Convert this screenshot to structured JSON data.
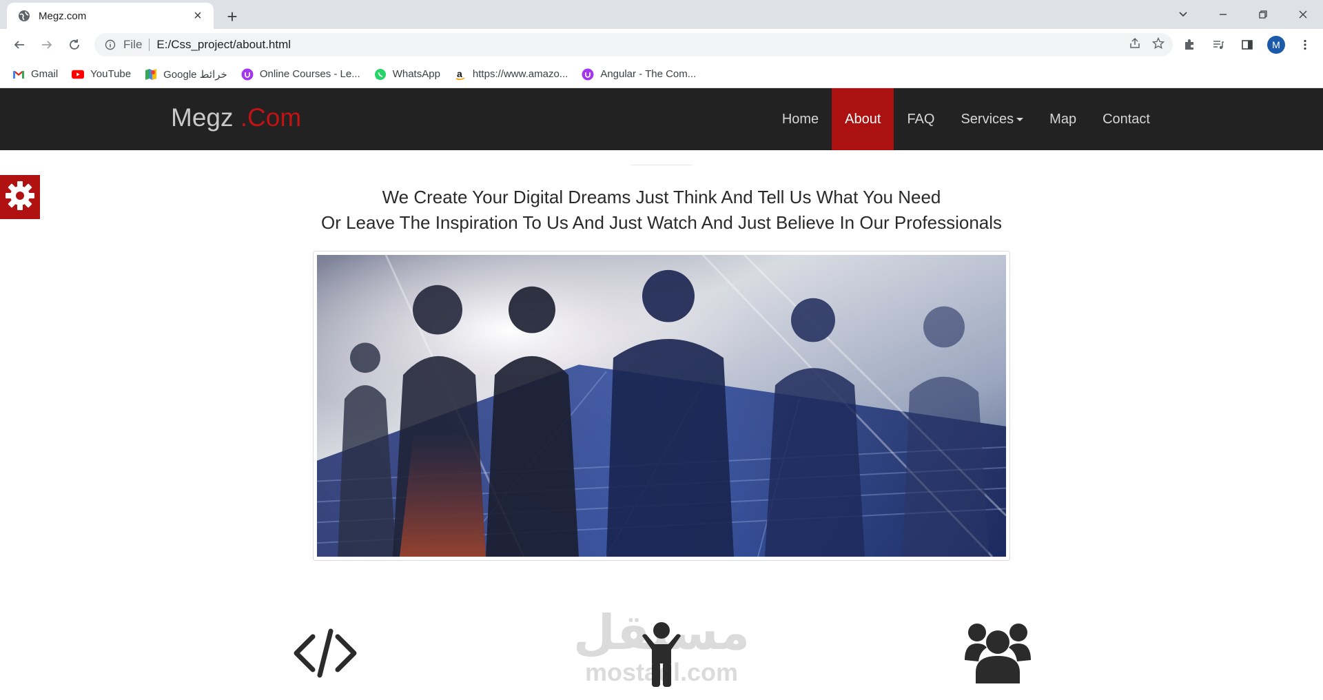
{
  "browser": {
    "tab_title": "Megz.com",
    "url_scheme": "File",
    "url": "E:/Css_project/about.html",
    "profile_initial": "M",
    "bookmarks": [
      {
        "label": "Gmail",
        "icon": "gmail-icon"
      },
      {
        "label": "YouTube",
        "icon": "youtube-icon"
      },
      {
        "label": "Google خرائط",
        "icon": "google-maps-icon"
      },
      {
        "label": "Online Courses - Le...",
        "icon": "udemy-icon"
      },
      {
        "label": "WhatsApp",
        "icon": "whatsapp-icon"
      },
      {
        "label": "https://www.amazo...",
        "icon": "amazon-icon"
      },
      {
        "label": "Angular - The Com...",
        "icon": "udemy-icon"
      }
    ]
  },
  "site": {
    "brand": "Megz",
    "brand_accent": ".Com",
    "menu": [
      {
        "label": "Home",
        "active": false
      },
      {
        "label": "About",
        "active": true
      },
      {
        "label": "FAQ",
        "active": false
      },
      {
        "label": "Services",
        "active": false,
        "dropdown": true
      },
      {
        "label": "Map",
        "active": false
      },
      {
        "label": "Contact",
        "active": false
      }
    ],
    "headline_line1": "We Create Your Digital Dreams Just Think And Tell Us What You Need",
    "headline_line2": "Or Leave The Inspiration To Us And Just Watch And Just Believe In Our Professionals",
    "features": [
      {
        "icon": "code-icon"
      },
      {
        "icon": "child-icon"
      },
      {
        "icon": "users-icon"
      }
    ],
    "watermark_arabic": "مستقل",
    "watermark_latin": "mostaql.com"
  },
  "colors": {
    "navbar": "#222222",
    "accent": "#ab1111",
    "brand_accent": "#c21214",
    "settings_box": "#b01212"
  }
}
